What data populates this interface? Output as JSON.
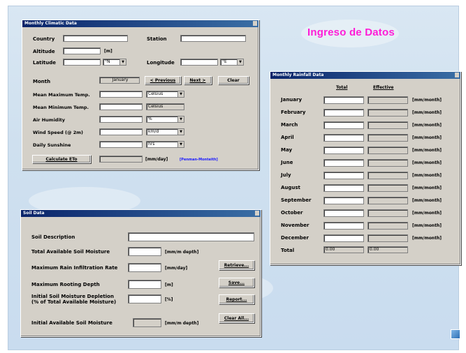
{
  "page_title": "Ingreso de Datos",
  "climate": {
    "title": "Monthly Climatic Data",
    "country_label": "Country",
    "station_label": "Station",
    "altitude_label": "Altitude",
    "altitude_unit": "[m]",
    "latitude_label": "Latitude",
    "latitude_dir": "°N",
    "longitude_label": "Longitude",
    "longitude_dir": "°E",
    "month_label": "Month",
    "month_value": "January",
    "prev_button": "< Previous",
    "next_button": "Next >",
    "clear_button": "Clear",
    "rows": [
      {
        "label": "Mean Maximum Temp.",
        "unit": "Celsius"
      },
      {
        "label": "Mean Minimum Temp.",
        "unit": "Celsius"
      },
      {
        "label": "Air Humidity",
        "unit": "%"
      },
      {
        "label": "Wind Speed (@ 2m)",
        "unit": "km/d"
      },
      {
        "label": "Daily Sunshine",
        "unit": "hrs"
      }
    ],
    "calc_button": "Calculate ETo",
    "eto_unit": "[mm/day]",
    "eto_method": "[Penman-Monteith]"
  },
  "rainfall": {
    "title": "Monthly Rainfall Data",
    "col_total": "Total",
    "col_effective": "Effective",
    "months": [
      "January",
      "February",
      "March",
      "April",
      "May",
      "June",
      "July",
      "August",
      "September",
      "October",
      "November",
      "December"
    ],
    "unit": "[mm/month]",
    "total_label": "Total",
    "total_value": "0.00",
    "effective_value": "0.00"
  },
  "soil": {
    "title": "Soil Data",
    "description_label": "Soil Description",
    "tasm_label": "Total Available Soil Moisture",
    "tasm_unit": "[mm/m depth]",
    "mril_label": "Maximum Rain Infiltration Rate",
    "mril_unit": "[mm/day]",
    "mrd_label": "Maximum Rooting Depth",
    "mrd_unit": "[m]",
    "ismd_label1": "Initial Soil Moisture Depletion",
    "ismd_label2": "(% of Total Available Moisture)",
    "ismd_unit": "[%]",
    "iasm_label": "Initial Available Soil Moisture",
    "iasm_unit": "[mm/m depth]",
    "retrieve_button": "Retrieve...",
    "save_button": "Save...",
    "report_button": "Report...",
    "clearall_button": "Clear All..."
  }
}
